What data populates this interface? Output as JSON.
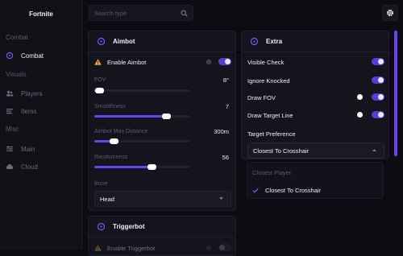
{
  "app": {
    "title": "Fortnite"
  },
  "colors": {
    "accent": "#6a44ee",
    "background": "#0c0c12",
    "panel": "#14141c",
    "warning": "#e8a33a"
  },
  "search": {
    "placeholder": "Search type",
    "icon": "search-icon"
  },
  "settings_icon": "gear-icon",
  "sidebar": {
    "sections": [
      {
        "label": "Combat",
        "items": [
          {
            "label": "Combat",
            "icon": "crosshair-icon",
            "active": true
          }
        ]
      },
      {
        "label": "Visuals",
        "items": [
          {
            "label": "Players",
            "icon": "users-icon",
            "active": false
          },
          {
            "label": "Items",
            "icon": "list-icon",
            "active": false
          }
        ]
      },
      {
        "label": "Misc",
        "items": [
          {
            "label": "Main",
            "icon": "sliders-icon",
            "active": false
          },
          {
            "label": "Cloud",
            "icon": "cloud-icon",
            "active": false
          }
        ]
      }
    ]
  },
  "aimbot": {
    "title": "Aimbot",
    "enable_label": "Enable Aimbot",
    "enabled": true,
    "fov": {
      "label": "FOV",
      "value": "8°",
      "fraction": 0.05
    },
    "smoothness": {
      "label": "Smoothness",
      "value": "7",
      "fraction": 0.75
    },
    "max_distance": {
      "label": "Aimbot Max Distance",
      "value": "300m",
      "fraction": 0.2
    },
    "randomness": {
      "label": "Randomness",
      "value": "56",
      "fraction": 0.6
    },
    "bone": {
      "label": "Bone",
      "value": "Head"
    }
  },
  "triggerbot": {
    "title": "Triggerbot",
    "enable_label": "Enable Triggerbot",
    "enabled": false
  },
  "extra": {
    "title": "Extra",
    "visible_check": {
      "label": "Visible Check",
      "enabled": true
    },
    "ignore_knocked": {
      "label": "Ignore Knocked",
      "enabled": true
    },
    "draw_fov": {
      "label": "Draw FOV",
      "enabled": true
    },
    "draw_target_line": {
      "label": "Draw Target Line",
      "enabled": true
    },
    "target_preference": {
      "label": "Target Preference",
      "value": "Closest To Crosshair"
    },
    "options": [
      {
        "label": "Closest Player",
        "selected": false
      },
      {
        "label": "Closest To Crosshair",
        "selected": true
      }
    ]
  }
}
